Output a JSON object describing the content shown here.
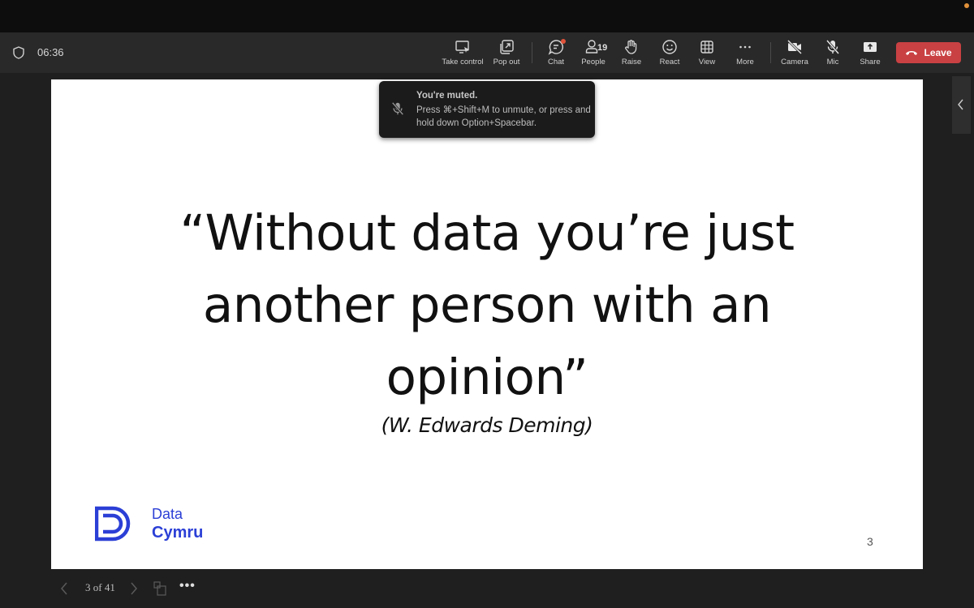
{
  "window": {
    "timer": "06:36"
  },
  "toolbar": {
    "buttons": [
      {
        "id": "take-control",
        "label": "Take control",
        "icon": "screen-cursor-icon"
      },
      {
        "id": "pop-out",
        "label": "Pop out",
        "icon": "pop-out-icon"
      },
      {
        "id": "chat",
        "label": "Chat",
        "icon": "chat-icon",
        "badge": true
      },
      {
        "id": "people",
        "label": "People",
        "icon": "people-icon",
        "count": "19"
      },
      {
        "id": "raise",
        "label": "Raise",
        "icon": "hand-icon"
      },
      {
        "id": "react",
        "label": "React",
        "icon": "smiley-icon"
      },
      {
        "id": "view",
        "label": "View",
        "icon": "grid-icon"
      },
      {
        "id": "more",
        "label": "More",
        "icon": "ellipsis-icon"
      },
      {
        "id": "camera",
        "label": "Camera",
        "icon": "camera-off-icon"
      },
      {
        "id": "mic",
        "label": "Mic",
        "icon": "mic-off-icon"
      },
      {
        "id": "share",
        "label": "Share",
        "icon": "share-icon"
      }
    ],
    "leave_label": "Leave"
  },
  "toast": {
    "title": "You're muted.",
    "body": "Press ⌘+Shift+M to unmute, or press and hold down Option+Spacebar."
  },
  "slide": {
    "quote_line1": "“Without data you’re just",
    "quote_line2": "another person with an",
    "quote_line3": "opinion”",
    "author": "(W. Edwards Deming)",
    "logo_line1": "Data",
    "logo_line2": "Cymru",
    "page_number": "3"
  },
  "navigation": {
    "current": 3,
    "total": 41,
    "label": "3 of 41",
    "more": "•••"
  },
  "colors": {
    "leave": "#c94143",
    "brand_blue": "#2b3fd6",
    "notification": "#e0913a"
  }
}
